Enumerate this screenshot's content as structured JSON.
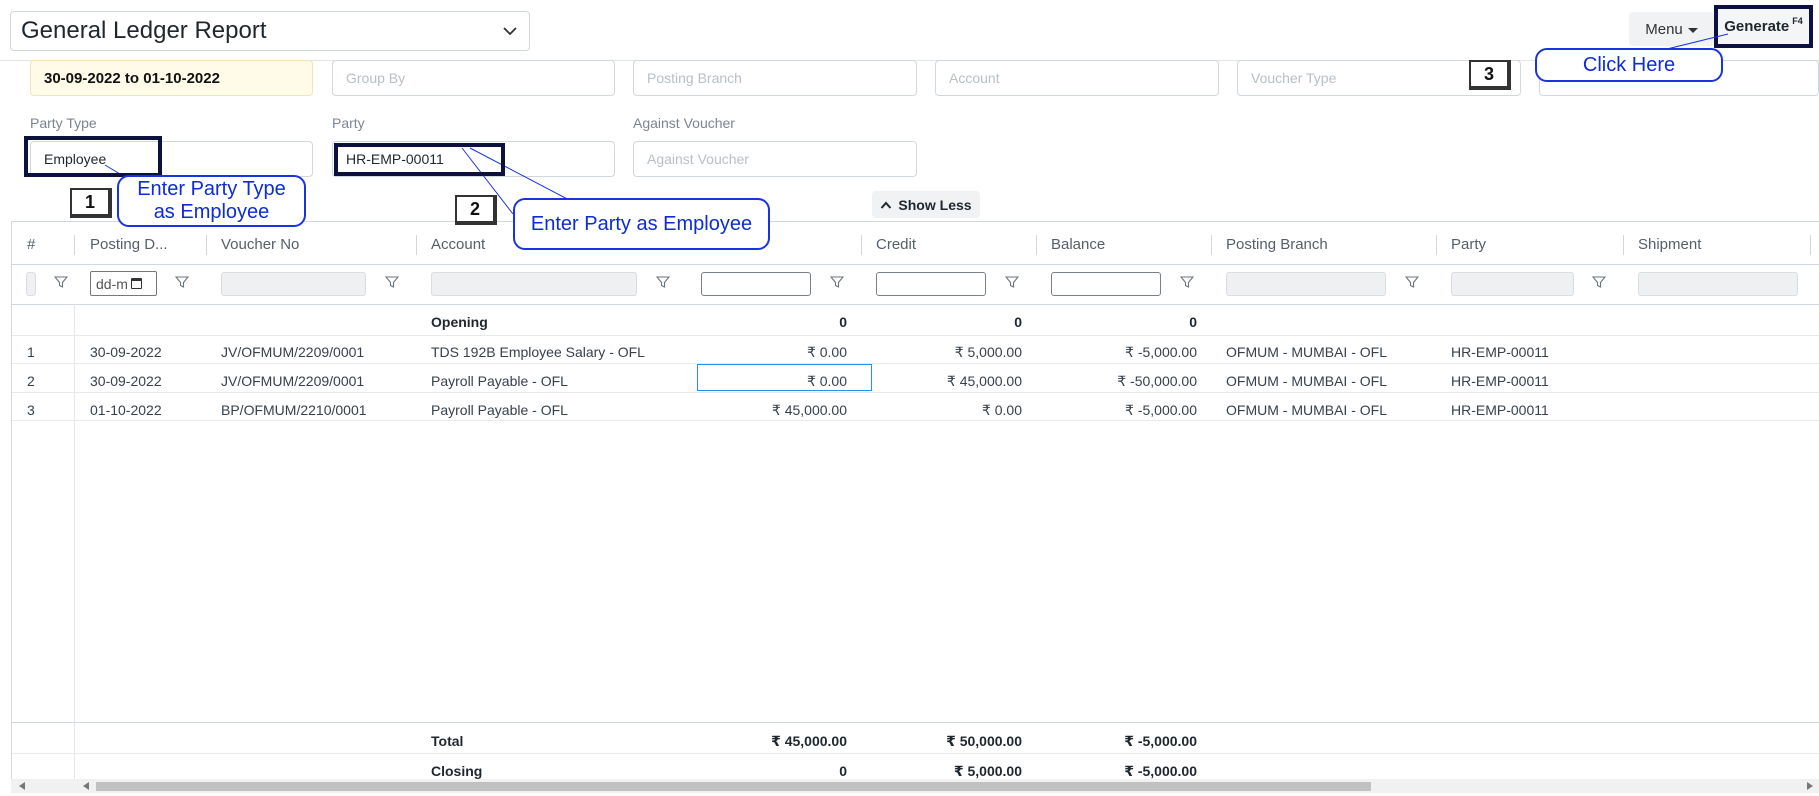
{
  "header": {
    "title": "General Ledger Report",
    "menu_label": "Menu",
    "generate_label": "Generate",
    "generate_shortcut": "F4"
  },
  "filters": {
    "date_range": "30-09-2022 to 01-10-2022",
    "group_by_placeholder": "Group By",
    "posting_branch_placeholder": "Posting Branch",
    "account_placeholder": "Account",
    "voucher_type_placeholder": "Voucher Type",
    "party_type_label": "Party Type",
    "party_type_value": "Employee",
    "party_label": "Party",
    "party_value": "HR-EMP-00011",
    "against_voucher_label": "Against Voucher",
    "against_voucher_placeholder": "Against Voucher",
    "show_less_label": "Show Less"
  },
  "annotations": {
    "step1": "1",
    "step2": "2",
    "step3": "3",
    "callout1_line1": "Enter Party Type",
    "callout1_line2": "as Employee",
    "callout2": "Enter Party as Employee",
    "callout3": "Click Here"
  },
  "table": {
    "columns": [
      "#",
      "Posting D...",
      "Voucher No",
      "Account",
      "Credit",
      "Balance",
      "Posting Branch",
      "Party",
      "Shipment"
    ],
    "date_filter_placeholder": "dd-m",
    "opening": {
      "label": "Opening",
      "debit": "0",
      "credit": "0",
      "balance": "0"
    },
    "rows": [
      {
        "idx": "1",
        "date": "30-09-2022",
        "voucher": "JV/OFMUM/2209/0001",
        "account": "TDS 192B Employee Salary - OFL",
        "debit": "₹ 0.00",
        "credit": "₹ 5,000.00",
        "balance": "₹ -5,000.00",
        "branch": "OFMUM - MUMBAI - OFL",
        "party": "HR-EMP-00011"
      },
      {
        "idx": "2",
        "date": "30-09-2022",
        "voucher": "JV/OFMUM/2209/0001",
        "account": "Payroll Payable - OFL",
        "debit": "₹ 0.00",
        "credit": "₹ 45,000.00",
        "balance": "₹ -50,000.00",
        "branch": "OFMUM - MUMBAI - OFL",
        "party": "HR-EMP-00011"
      },
      {
        "idx": "3",
        "date": "01-10-2022",
        "voucher": "BP/OFMUM/2210/0001",
        "account": "Payroll Payable - OFL",
        "debit": "₹ 45,000.00",
        "credit": "₹ 0.00",
        "balance": "₹ -5,000.00",
        "branch": "OFMUM - MUMBAI - OFL",
        "party": "HR-EMP-00011"
      }
    ],
    "total": {
      "label": "Total",
      "debit": "₹ 45,000.00",
      "credit": "₹ 50,000.00",
      "balance": "₹ -5,000.00"
    },
    "closing": {
      "label": "Closing",
      "debit": "0",
      "credit": "₹ 5,000.00",
      "balance": "₹ -5,000.00"
    }
  },
  "colors": {
    "annotation_border": "#0d1140",
    "callout_blue": "#0d2bd8",
    "date_field_bg": "#fffbe8",
    "selection_blue": "#2490ef"
  }
}
